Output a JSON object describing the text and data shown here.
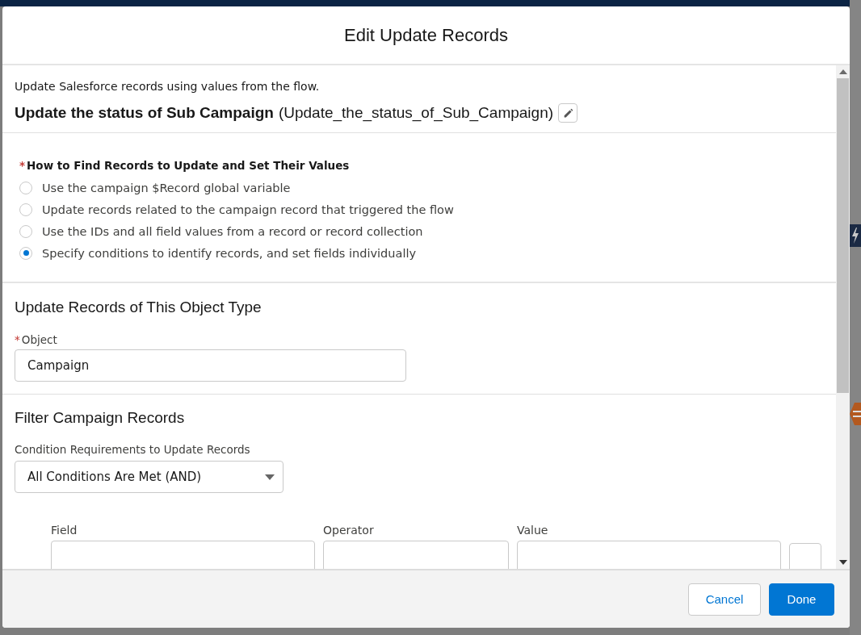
{
  "modal": {
    "title": "Edit Update Records",
    "description": "Update Salesforce records using values from the flow.",
    "element_label": "Update the status of Sub Campaign",
    "api_name": "(Update_the_status_of_Sub_Campaign)",
    "how_to_find": {
      "label": "How to Find Records to Update and Set Their Values",
      "required_mark": "*",
      "options": [
        {
          "label": "Use the campaign $Record global variable",
          "selected": false
        },
        {
          "label": "Update records related to the campaign record that triggered the flow",
          "selected": false
        },
        {
          "label": "Use the IDs and all field values from a record or record collection",
          "selected": false
        },
        {
          "label": "Specify conditions to identify records, and set fields individually",
          "selected": true
        }
      ]
    },
    "object_section": {
      "heading": "Update Records of This Object Type",
      "field_label": "Object",
      "required_mark": "*",
      "value": "Campaign"
    },
    "filter_section": {
      "heading": "Filter Campaign Records",
      "requirement_label": "Condition Requirements to Update Records",
      "requirement_value": "All Conditions Are Met (AND)",
      "columns": [
        "Field",
        "Operator",
        "Value"
      ]
    },
    "buttons": [
      {
        "label": "Cancel",
        "kind": "neutral"
      },
      {
        "label": "Done",
        "kind": "brand"
      }
    ]
  }
}
